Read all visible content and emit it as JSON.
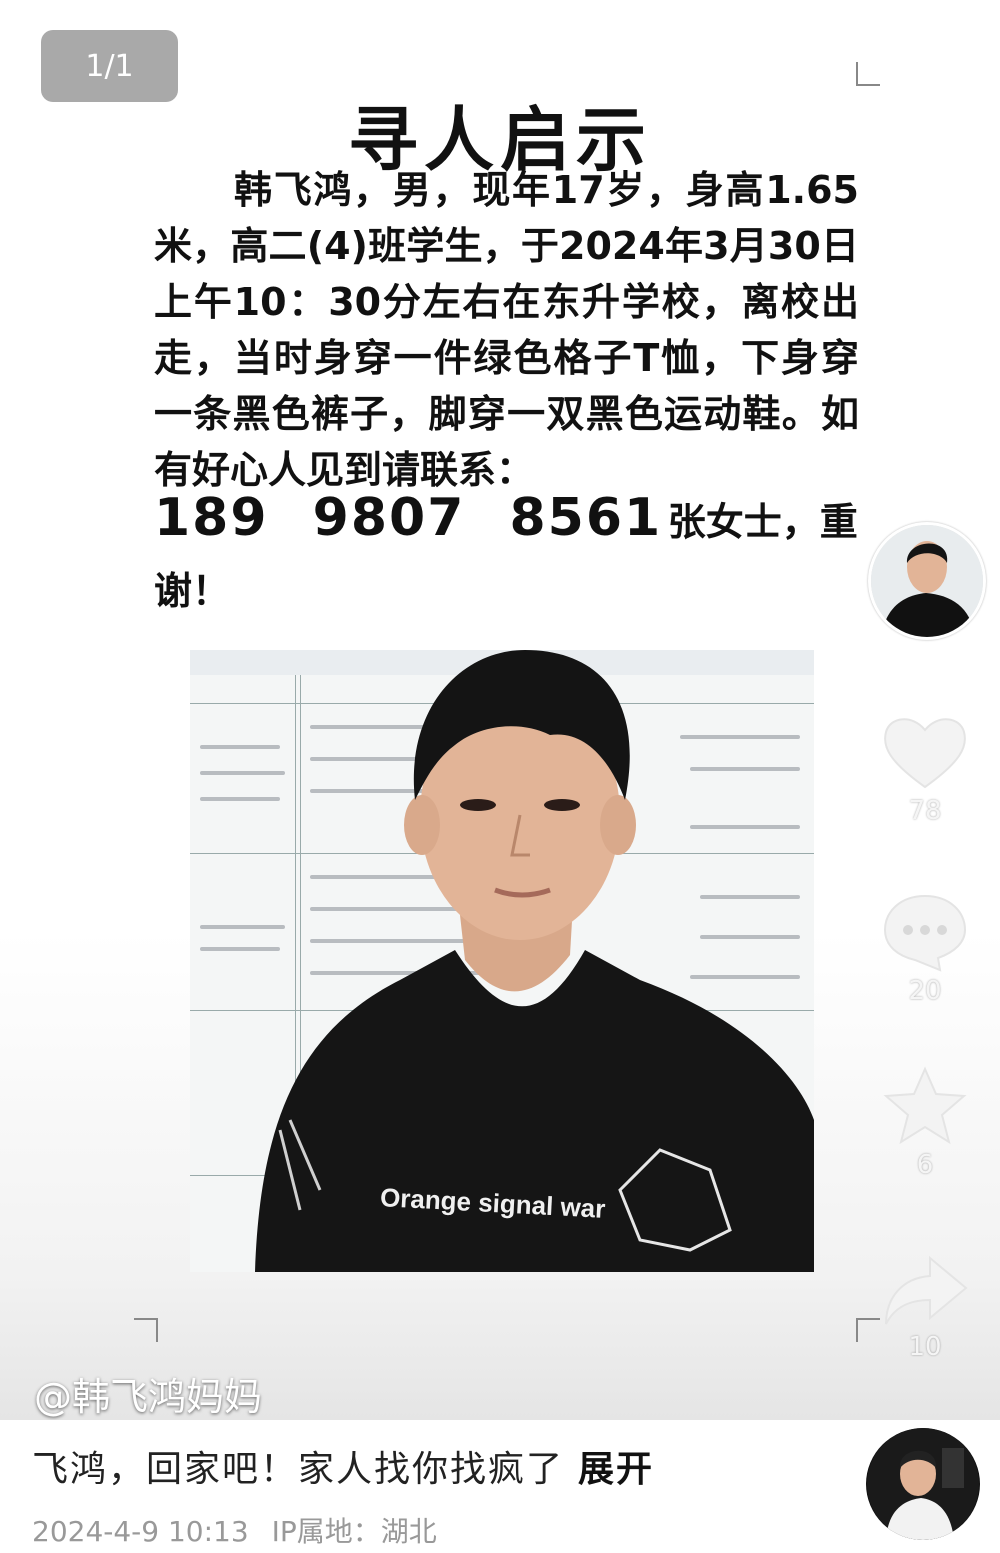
{
  "viewer": {
    "counter": "1/1"
  },
  "poster": {
    "title": "寻人启示",
    "body": "韩飞鸿，男，现年17岁，身高1.65米，高二(4)班学生，于2024年3月30日上午10：30分左右在东升学校，离校出走，当时身穿一件绿色格子T恤，下身穿一条黑色裤子，脚穿一双黑色运动鞋。如有好心人见到请联系：",
    "phone": "189 9807 8561",
    "contact": "张女士，重",
    "thanks": "谢！",
    "shirt_text": "Orange signal war"
  },
  "actions": {
    "likes": "78",
    "comments": "20",
    "favorites": "6",
    "shares": "10"
  },
  "post": {
    "author_handle": "@韩飞鸿妈妈",
    "caption": "飞鸿，回家吧！家人找你找疯了",
    "expand_label": "展开",
    "timestamp": "2024-4-9 10:13",
    "location": "IP属地：湖北"
  }
}
